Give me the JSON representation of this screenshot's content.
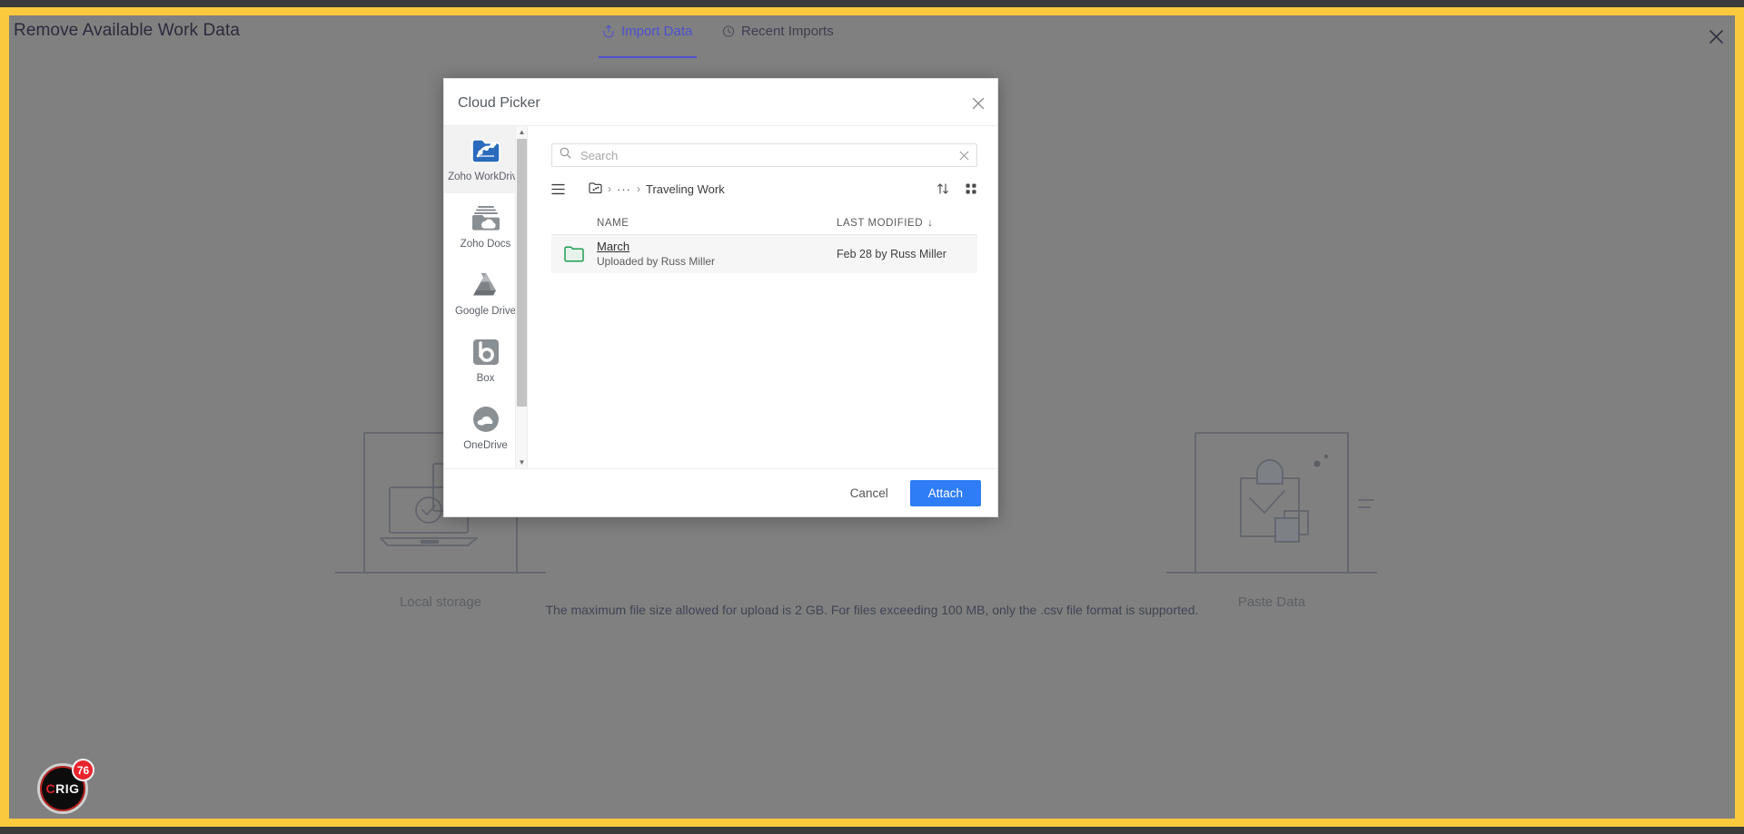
{
  "header": {
    "title": "Remove Available Work Data",
    "close_icon": "close-icon",
    "tabs": [
      {
        "label": "Import Data",
        "icon": "upload-icon",
        "active": true
      },
      {
        "label": "Recent Imports",
        "icon": "clock-icon",
        "active": false
      }
    ]
  },
  "background": {
    "cards": [
      {
        "caption": "Local storage",
        "icon": "laptop-check-icon"
      },
      {
        "caption": "Paste Data",
        "icon": "clipboard-check-icon"
      }
    ],
    "note": "The maximum file size allowed for upload is 2 GB. For files exceeding 100 MB, only the .csv file format is supported."
  },
  "rig_badge": {
    "text_left": "C",
    "text_right": "RIG",
    "count": "76"
  },
  "modal": {
    "title": "Cloud Picker",
    "close_icon": "close-icon",
    "providers": [
      {
        "label": "Zoho WorkDrive",
        "icon": "zoho-workdrive-icon",
        "selected": true
      },
      {
        "label": "Zoho Docs",
        "icon": "zoho-docs-icon",
        "selected": false
      },
      {
        "label": "Google Drive",
        "icon": "google-drive-icon",
        "selected": false
      },
      {
        "label": "Box",
        "icon": "box-icon",
        "selected": false
      },
      {
        "label": "OneDrive",
        "icon": "onedrive-icon",
        "selected": false
      }
    ],
    "search": {
      "placeholder": "Search",
      "value": "",
      "search_icon": "search-icon",
      "clear_icon": "clear-icon"
    },
    "breadcrumb": {
      "menu_icon": "hamburger-menu-icon",
      "root_icon": "workdrive-folder-icon",
      "ellipsis": "···",
      "separator": "›",
      "current": "Traveling Work",
      "actions": [
        {
          "icon": "sort-icon",
          "name": "sort-toggle"
        },
        {
          "icon": "grid-view-icon",
          "name": "grid-view-toggle"
        }
      ]
    },
    "table": {
      "columns": [
        "NAME",
        "LAST MODIFIED"
      ],
      "sort_indicator": "↓",
      "rows": [
        {
          "icon": "folder-icon",
          "name": "March",
          "subtitle": "Uploaded by Russ Miller",
          "last_modified": "Feb 28 by Russ Miller"
        }
      ]
    },
    "footer": {
      "cancel_label": "Cancel",
      "attach_label": "Attach"
    }
  },
  "colors": {
    "frame_yellow": "#fbc93d",
    "page_gray": "#808080",
    "accent_blue": "#2e7df6",
    "tab_active": "#4f4fd0",
    "folder_green": "#1f9d55",
    "badge_red": "#e8232c"
  }
}
